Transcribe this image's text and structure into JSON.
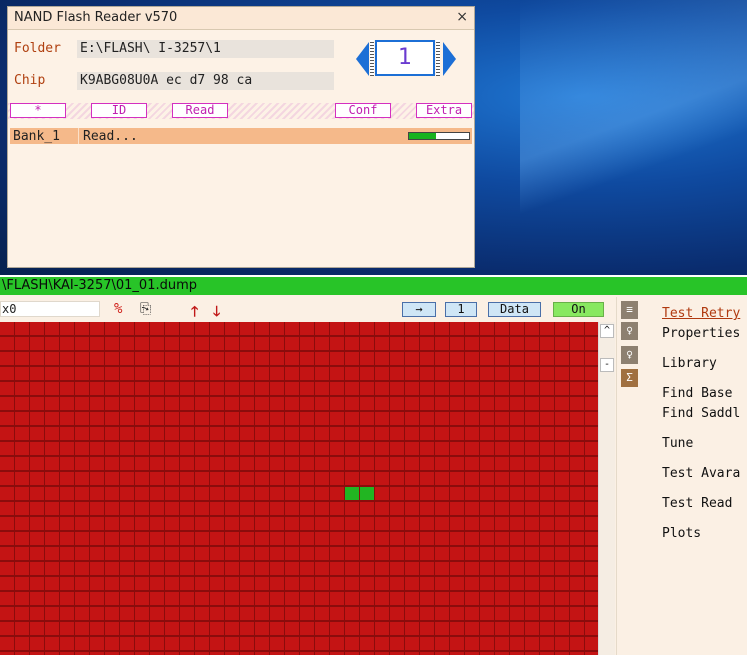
{
  "nand": {
    "title": "NAND Flash Reader v570",
    "close": "×",
    "folder_label": "Folder",
    "folder_value": "E:\\FLASH\\   I-3257\\1",
    "chip_label": "Chip",
    "chip_value": "K9ABG08U0A   ec d7 98 ca",
    "counter": "1",
    "buttons": [
      "*",
      "ID",
      "Read",
      "Conf",
      "Extra"
    ],
    "bank": "Bank_1",
    "status": "Read...",
    "progress": 0.45,
    "colors": {
      "accent": "#1c6fd6",
      "progress": "#19b21f",
      "bankbar": "#f5b98a"
    }
  },
  "dump": {
    "path": "\\FLASH\\KAI-3257\\01_01.dump",
    "address": "x0",
    "icons": [
      "percent-icon",
      "copy-icon",
      "arrow-up-icon",
      "arrow-down-icon"
    ],
    "toolbar": {
      "arrow": "→",
      "count": "1",
      "data": "Data",
      "on": "On"
    },
    "scroll_up": "^",
    "scroll_minus": "-",
    "grid": {
      "cols": 40,
      "rows": 24,
      "good_cells": [
        [
          23,
          11
        ],
        [
          24,
          11
        ]
      ],
      "colors": {
        "bad": "#c41414",
        "good": "#22b522",
        "grid": "#8b0c0c"
      }
    },
    "menu": [
      "Test Retry",
      "Properties",
      "Library",
      "Find Base",
      "Find Saddl",
      "Tune",
      "Test Avara",
      "Test Read",
      "Plots"
    ]
  }
}
